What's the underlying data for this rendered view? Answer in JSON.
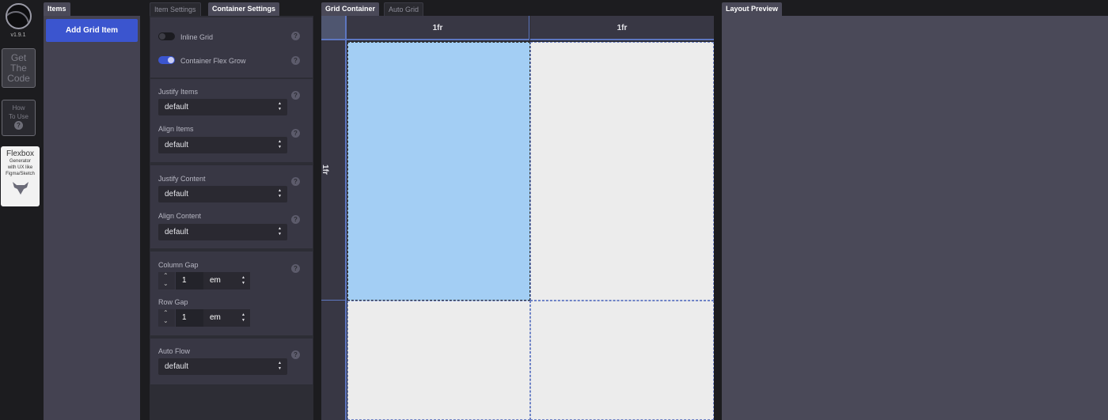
{
  "toolbar": {
    "version": "v1.9.1",
    "get_code": [
      "Get",
      "The",
      "Code"
    ],
    "how_to_use": [
      "How",
      "To Use"
    ],
    "help_glyph": "?",
    "flexbox_ad": {
      "title": "Flexbox",
      "lines": [
        "Generator",
        "with UX like",
        "Figma/Sketch"
      ]
    }
  },
  "items_panel": {
    "tab_label": "Items",
    "add_button": "Add Grid Item"
  },
  "settings_panel": {
    "tabs": [
      {
        "label": "Item Settings",
        "active": false
      },
      {
        "label": "Container Settings",
        "active": true
      }
    ],
    "inline_grid": {
      "label": "Inline Grid",
      "enabled": false
    },
    "container_flex_grow": {
      "label": "Container Flex Grow",
      "enabled": true
    },
    "justify_items": {
      "label": "Justify Items",
      "value": "default"
    },
    "align_items": {
      "label": "Align Items",
      "value": "default"
    },
    "justify_content": {
      "label": "Justify Content",
      "value": "default"
    },
    "align_content": {
      "label": "Align Content",
      "value": "default"
    },
    "column_gap": {
      "label": "Column Gap",
      "value": "1",
      "unit": "em"
    },
    "row_gap": {
      "label": "Row Gap",
      "value": "1",
      "unit": "em"
    },
    "auto_flow": {
      "label": "Auto Flow",
      "value": "default"
    },
    "help_glyph": "?"
  },
  "grid_panel": {
    "tabs": [
      {
        "label": "Grid Container",
        "active": true
      },
      {
        "label": "Auto Grid",
        "active": false
      }
    ],
    "columns": [
      "1fr",
      "1fr"
    ],
    "rows": [
      "1fr",
      ""
    ],
    "selected_cell": "row 1, column 1"
  },
  "preview_panel": {
    "tab_label": "Layout Preview"
  },
  "colors": {
    "accent": "#3b55cf",
    "selected_cell": "#a3cef4",
    "cell": "#ececec"
  }
}
